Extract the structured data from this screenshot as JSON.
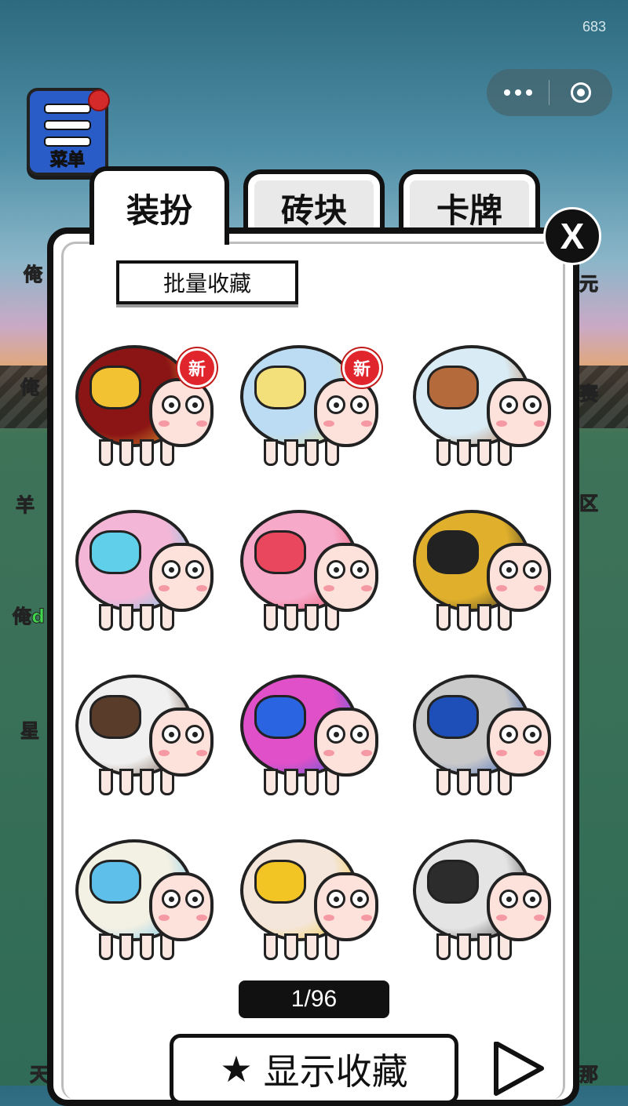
{
  "status": {
    "counter": "683"
  },
  "side_menu": {
    "menu_label": "菜单",
    "left_labels": [
      "俺",
      "俺",
      "羊",
      "俺d",
      "星",
      "天"
    ],
    "right_labels": [
      "元",
      "赛",
      "区",
      "那"
    ]
  },
  "tabs": [
    {
      "label": "装扮",
      "active": true
    },
    {
      "label": "砖块",
      "active": false
    },
    {
      "label": "卡牌",
      "active": false
    }
  ],
  "close_label": "X",
  "batch_collect_label": "批量收藏",
  "items": [
    {
      "name": "cage-heart-sheep",
      "new": true,
      "badge": "新",
      "body": "#8b1414",
      "accent": "#f2c232"
    },
    {
      "name": "bubble-bonnet-sheep",
      "new": true,
      "badge": "新",
      "body": "#bcdcf4",
      "accent": "#f4e07a"
    },
    {
      "name": "capybara-sheep",
      "new": false,
      "badge": "",
      "body": "#d9ecf5",
      "accent": "#b56a3c"
    },
    {
      "name": "ferris-wheel-sheep",
      "new": false,
      "badge": "",
      "body": "#f4b6d7",
      "accent": "#60d0ea"
    },
    {
      "name": "pink-brain-sheep",
      "new": false,
      "badge": "",
      "body": "#f7a9c9",
      "accent": "#e8475d"
    },
    {
      "name": "bee-sheep",
      "new": false,
      "badge": "",
      "body": "#e0b02c",
      "accent": "#222222"
    },
    {
      "name": "lady-hat-sheep",
      "new": false,
      "badge": "",
      "body": "#f0f0f0",
      "accent": "#5a3c2a"
    },
    {
      "name": "mailbox-sheep",
      "new": false,
      "badge": "",
      "body": "#e050c8",
      "accent": "#2a64e0"
    },
    {
      "name": "blue-hoodie-sheep",
      "new": false,
      "badge": "",
      "body": "#c9c9c9",
      "accent": "#1e4fb8"
    },
    {
      "name": "fountain-sheep",
      "new": false,
      "badge": "",
      "body": "#f3f0e4",
      "accent": "#5ec0ea"
    },
    {
      "name": "cupid-sheep",
      "new": false,
      "badge": "",
      "body": "#f4e6da",
      "accent": "#f3c524"
    },
    {
      "name": "cloud-ink-sheep",
      "new": false,
      "badge": "",
      "body": "#e4e4e4",
      "accent": "#2c2c2c"
    }
  ],
  "pager": {
    "text": "1/96"
  },
  "show_collection_label": "显示收藏",
  "colors": {
    "panel": "#ffffff",
    "border": "#111111",
    "badge": "#e0252c"
  }
}
